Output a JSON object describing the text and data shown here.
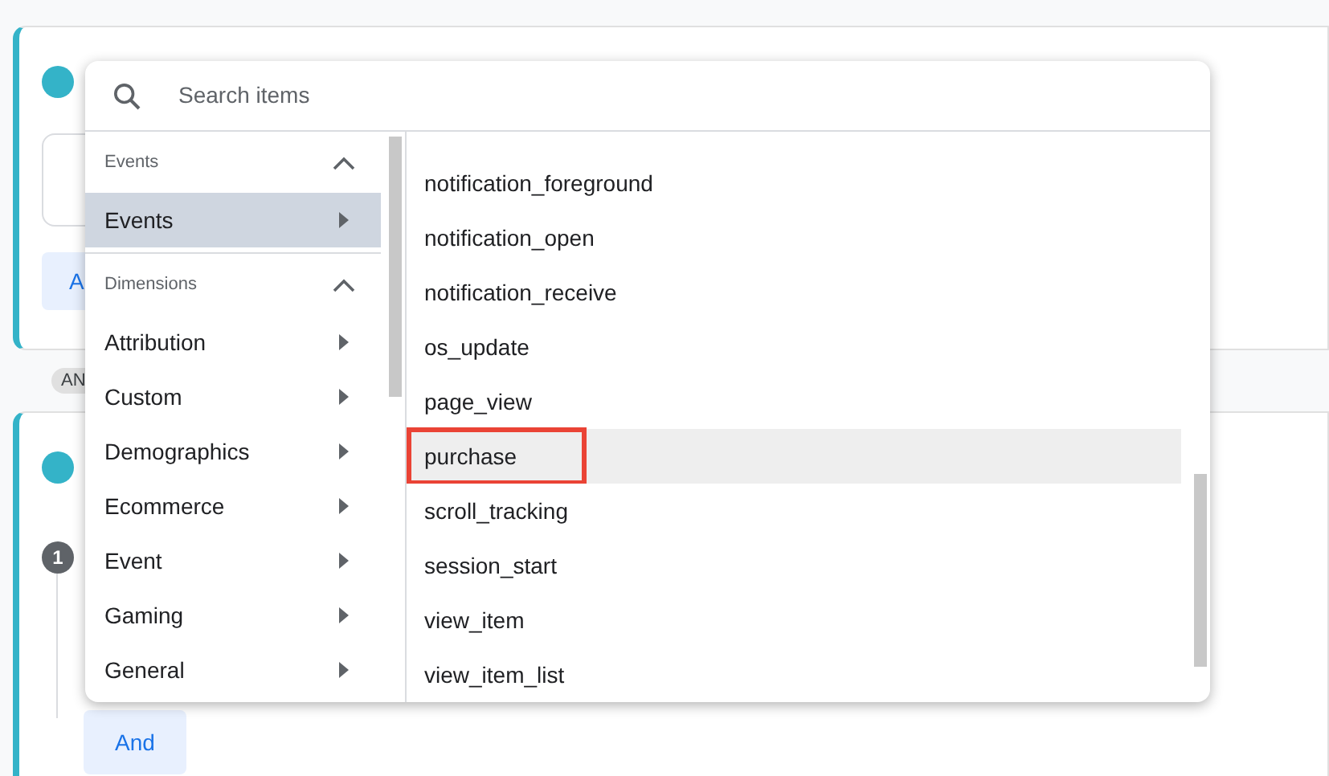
{
  "background": {
    "card_1": {
      "button": "A"
    },
    "separator_chip": "AN",
    "card_2": {
      "step_badge": "1",
      "button": "And"
    }
  },
  "picker": {
    "search": {
      "placeholder": "Search items"
    },
    "groups": [
      {
        "header": "Events",
        "expanded": true,
        "items": [
          {
            "label": "Events",
            "selected": true
          }
        ]
      },
      {
        "header": "Dimensions",
        "expanded": true,
        "items": [
          {
            "label": "Attribution",
            "selected": false
          },
          {
            "label": "Custom",
            "selected": false
          },
          {
            "label": "Demographics",
            "selected": false
          },
          {
            "label": "Ecommerce",
            "selected": false
          },
          {
            "label": "Event",
            "selected": false
          },
          {
            "label": "Gaming",
            "selected": false
          },
          {
            "label": "General",
            "selected": false
          }
        ]
      }
    ],
    "options": [
      {
        "label": "notification_foreground",
        "hovered": false,
        "outlined": false
      },
      {
        "label": "notification_open",
        "hovered": false,
        "outlined": false
      },
      {
        "label": "notification_receive",
        "hovered": false,
        "outlined": false
      },
      {
        "label": "os_update",
        "hovered": false,
        "outlined": false
      },
      {
        "label": "page_view",
        "hovered": false,
        "outlined": false
      },
      {
        "label": "purchase",
        "hovered": true,
        "outlined": true
      },
      {
        "label": "scroll_tracking",
        "hovered": false,
        "outlined": false
      },
      {
        "label": "session_start",
        "hovered": false,
        "outlined": false
      },
      {
        "label": "view_item",
        "hovered": false,
        "outlined": false
      },
      {
        "label": "view_item_list",
        "hovered": false,
        "outlined": false
      }
    ]
  }
}
